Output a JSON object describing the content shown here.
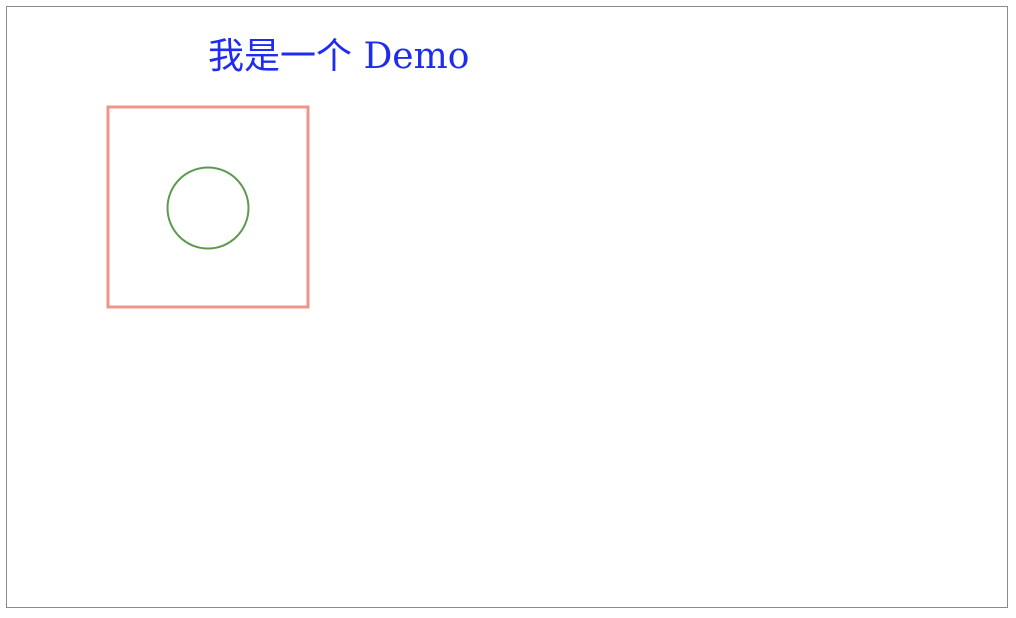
{
  "demo": {
    "title": "我是一个 Demo",
    "title_color": "#1d2cf0",
    "square_stroke": "#f0948a",
    "circle_stroke": "#5d9a4f"
  }
}
